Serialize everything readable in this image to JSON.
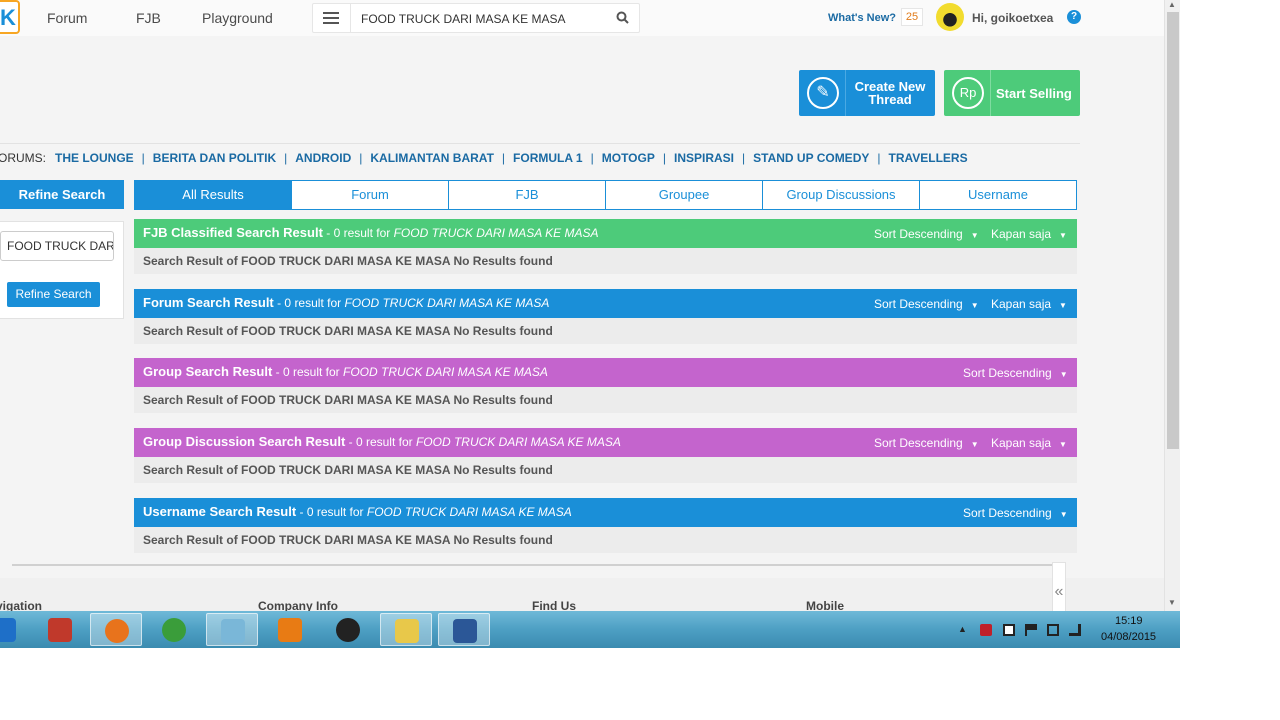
{
  "nav": {
    "links": [
      "Forum",
      "FJB",
      "Playground"
    ],
    "search_value": "FOOD TRUCK DARI MASA KE MASA",
    "whats_new": "What's New?",
    "notif_count": "25",
    "greeting": "Hi, goikoetxea",
    "help": "?"
  },
  "actions": {
    "create_thread": "Create New Thread",
    "start_selling": "Start Selling",
    "rp": "Rp"
  },
  "forums": {
    "label": "ORUMS:",
    "items": [
      "THE LOUNGE",
      "BERITA DAN POLITIK",
      "ANDROID",
      "KALIMANTAN BARAT",
      "FORMULA 1",
      "MOTOGP",
      "INSPIRASI",
      "STAND UP COMEDY",
      "TRAVELLERS"
    ]
  },
  "refine": {
    "header": "Refine Search",
    "input_value": "FOOD TRUCK DAR",
    "button": "Refine Search"
  },
  "tabs": [
    "All Results",
    "Forum",
    "FJB",
    "Groupee",
    "Group Discussions",
    "Username"
  ],
  "results": [
    {
      "title": "FJB Classified Search Result",
      "meta": " - 0 result for ",
      "query": "FOOD TRUCK DARI MASA KE MASA",
      "color": "#4dcb7a",
      "sort": "Sort Descending",
      "time": "Kapan saja",
      "body": "Search Result of FOOD TRUCK DARI MASA KE MASA No Results found"
    },
    {
      "title": "Forum Search Result",
      "meta": " - 0 result for ",
      "query": "FOOD TRUCK DARI MASA KE MASA",
      "color": "#1a8fd8",
      "sort": "Sort Descending",
      "time": "Kapan saja",
      "body": "Search Result of FOOD TRUCK DARI MASA KE MASA No Results found"
    },
    {
      "title": "Group Search Result",
      "meta": " - 0 result for ",
      "query": "FOOD TRUCK DARI MASA KE MASA",
      "color": "#c464cd",
      "sort": "Sort Descending",
      "time": "",
      "body": "Search Result of FOOD TRUCK DARI MASA KE MASA No Results found"
    },
    {
      "title": "Group Discussion Search Result",
      "meta": " - 0 result for ",
      "query": "FOOD TRUCK DARI MASA KE MASA",
      "color": "#c464cd",
      "sort": "Sort Descending",
      "time": "Kapan saja",
      "body": "Search Result of FOOD TRUCK DARI MASA KE MASA No Results found"
    },
    {
      "title": "Username Search Result",
      "meta": " - 0 result for ",
      "query": "FOOD TRUCK DARI MASA KE MASA",
      "color": "#1a8fd8",
      "sort": "Sort Descending",
      "time": "",
      "body": "Search Result of FOOD TRUCK DARI MASA KE MASA No Results found"
    }
  ],
  "footer": {
    "headings": [
      "vigation",
      "Company Info",
      "Find Us",
      "Mobile"
    ],
    "collapse": "«"
  },
  "taskbar": {
    "time": "15:19",
    "date": "04/08/2015",
    "apps": [
      "ie-icon",
      "book-icon",
      "firefox-icon",
      "chrome-icon",
      "notepad-icon",
      "media-player-icon",
      "penguin-icon",
      "folder-icon",
      "word-icon"
    ]
  }
}
